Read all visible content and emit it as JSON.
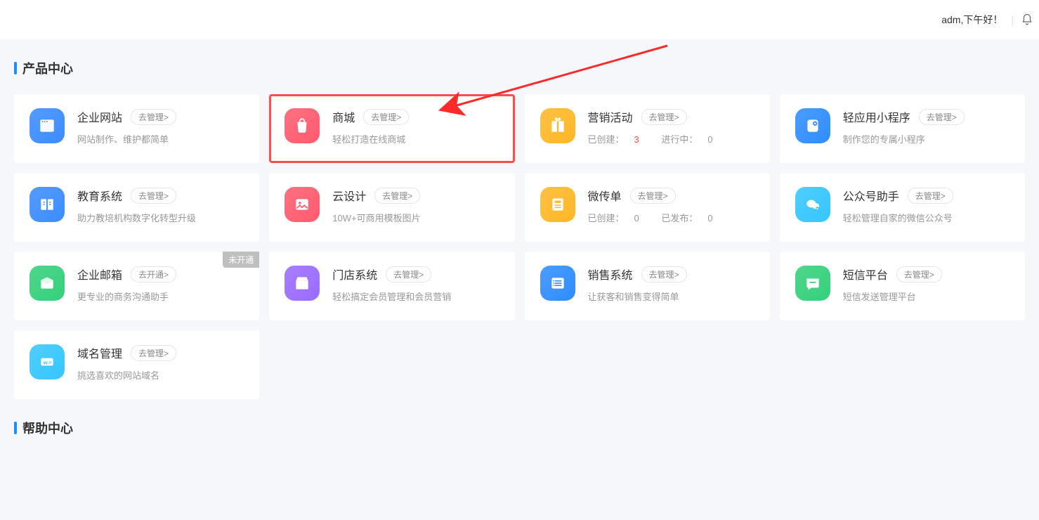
{
  "header": {
    "greeting": "adm,下午好！"
  },
  "sections": {
    "products_title": "产品中心",
    "help_title": "帮助中心"
  },
  "cards": [
    {
      "id": "website",
      "title": "企业网站",
      "btn": "去管理>",
      "desc": "网站制作、维护都简单",
      "icon_color": "#3b8cff"
    },
    {
      "id": "mall",
      "title": "商城",
      "btn": "去管理>",
      "desc": "轻松打造在线商城",
      "icon_color": "#ff5b6e",
      "highlight": true
    },
    {
      "id": "marketing",
      "title": "营销活动",
      "btn": "去管理>",
      "stats": {
        "created_label": "已创建：",
        "created_value": "3",
        "running_label": "进行中：",
        "running_value": "0"
      },
      "icon_color": "#ffb726"
    },
    {
      "id": "miniapp",
      "title": "轻应用小程序",
      "btn": "去管理>",
      "desc": "制作您的专属小程序",
      "icon_color": "#2f8dff"
    },
    {
      "id": "edu",
      "title": "教育系统",
      "btn": "去管理>",
      "desc": "助力教培机构数字化转型升级",
      "icon_color": "#3b8cff"
    },
    {
      "id": "design",
      "title": "云设计",
      "btn": "去管理>",
      "desc": "10W+可商用模板图片",
      "icon_color": "#ff5b6e"
    },
    {
      "id": "flyer",
      "title": "微传单",
      "btn": "去管理>",
      "stats": {
        "created_label": "已创建：",
        "created_value": "0",
        "running_label": "已发布：",
        "running_value": "0"
      },
      "icon_color": "#ffb726"
    },
    {
      "id": "wechat",
      "title": "公众号助手",
      "btn": "去管理>",
      "desc": "轻松管理自家的微信公众号",
      "icon_color": "#35c6ff"
    },
    {
      "id": "mailbox",
      "title": "企业邮箱",
      "btn": "去开通>",
      "desc": "更专业的商务沟通助手",
      "icon_color": "#34d07b",
      "badge": "未开通"
    },
    {
      "id": "store",
      "title": "门店系统",
      "btn": "去管理>",
      "desc": "轻松搞定会员管理和会员营销",
      "icon_color": "#9a6bff"
    },
    {
      "id": "sales",
      "title": "销售系统",
      "btn": "去管理>",
      "desc": "让获客和销售变得简单",
      "icon_color": "#2f8dff"
    },
    {
      "id": "sms",
      "title": "短信平台",
      "btn": "去管理>",
      "desc": "短信发送管理平台",
      "icon_color": "#34d07b"
    },
    {
      "id": "domain",
      "title": "域名管理",
      "btn": "去管理>",
      "desc": "挑选喜欢的网站域名",
      "icon_color": "#35c6ff"
    }
  ]
}
